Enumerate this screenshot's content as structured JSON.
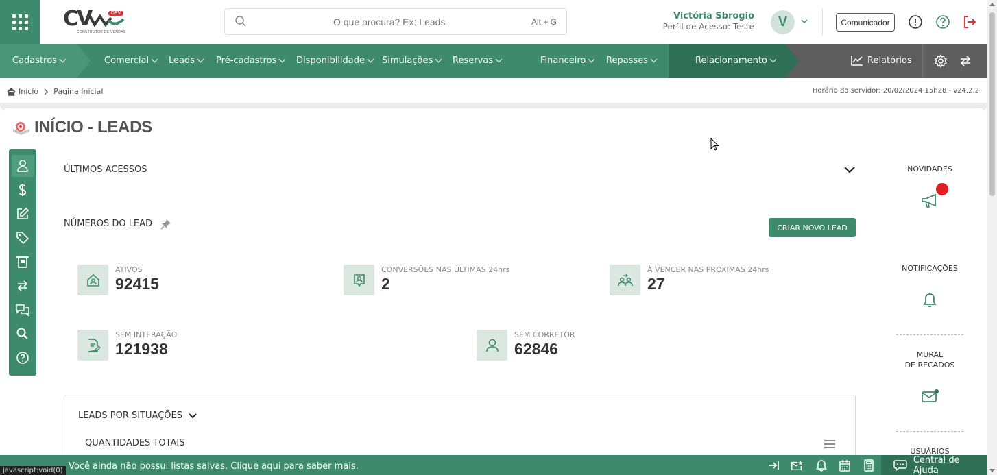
{
  "header": {
    "logo_text": "CV",
    "logo_badge": "DEV",
    "logo_sub": "CONSTRUTOR DE VENDAS",
    "search_placeholder": "O que procura? Ex: Leads",
    "search_shortcut": "Alt + G",
    "user_name": "Victória Sbrogio",
    "user_role": "Perfil de Acesso: Teste",
    "avatar_initial": "V",
    "communicator_label": "Comunicador"
  },
  "nav": {
    "items": [
      {
        "label": "Cadastros"
      },
      {
        "label": "Comercial"
      },
      {
        "label": "Leads"
      },
      {
        "label": "Pré-cadastros"
      },
      {
        "label": "Disponibilidade"
      },
      {
        "label": "Simulações"
      },
      {
        "label": "Reservas"
      },
      {
        "label": "Financeiro"
      },
      {
        "label": "Repasses"
      },
      {
        "label": "Relacionamento"
      }
    ],
    "reports_label": "Relatórios"
  },
  "breadcrumb": {
    "home": "Início",
    "current": "Página Inicial",
    "server_time": "Horário do servidor: 20/02/2024 15h28 - v24.2.2"
  },
  "page": {
    "title": "INÍCIO - LEADS"
  },
  "main": {
    "last_access_label": "ÚLTIMOS ACESSOS",
    "lead_numbers_label": "NÚMEROS DO LEAD",
    "new_lead_button": "CRIAR NOVO LEAD",
    "stats": [
      {
        "label": "ATIVOS",
        "value": "92415"
      },
      {
        "label": "CONVERSÕES NAS ÚLTIMAS 24hrs",
        "value": "2"
      },
      {
        "label": "À VENCER NAS PRÓXIMAS 24hrs",
        "value": "27"
      },
      {
        "label": "SEM INTERAÇÃO",
        "value": "121938"
      },
      {
        "label": "SEM CORRETOR",
        "value": "62846"
      }
    ],
    "leads_by_status_label": "LEADS POR SITUAÇÕES",
    "totals_label": "QUANTIDADES TOTAIS"
  },
  "right_panel": {
    "news_label": "NOVIDADES",
    "notifications_label": "NOTIFICAÇÕES",
    "board_label_1": "MURAL",
    "board_label_2": "DE RECADOS",
    "users_label": "USUÁRIOS"
  },
  "bottom": {
    "message": "Você ainda não possui listas salvas. Clique aqui para saber mais.",
    "status_url": "javascript:void(0)",
    "help_label": "Central de Ajuda"
  },
  "colors": {
    "primary": "#3e8a6c",
    "primary_dark": "#2f6f55",
    "reports_bg": "#5e5e5e",
    "logout_red": "#d9363e",
    "badge_red": "#e02020"
  }
}
